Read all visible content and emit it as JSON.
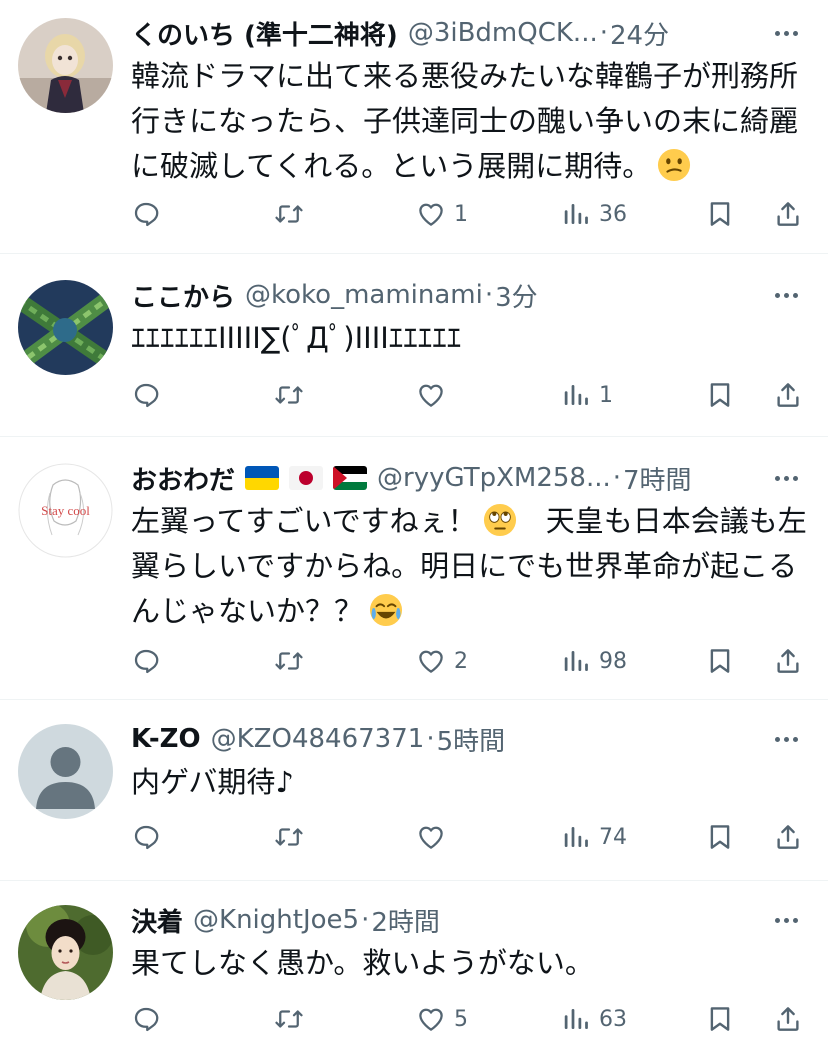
{
  "tweets": [
    {
      "name": "くのいち (準十二神将)",
      "handle": "@3iBdmQCK...",
      "sep": "·",
      "time": "24分",
      "text": "韓流ドラマに出て来る悪役みたいな韓鶴子が刑務所行きになったら、子供達同士の醜い争いの末に綺麗に破滅してくれる。という展開に期待。",
      "trailing_emoji": "confused-face",
      "likes": "1",
      "views": "36"
    },
    {
      "name": "ここから",
      "handle": "@koko_maminami",
      "sep": "·",
      "time": "3分",
      "text": "ｴｴｴｴｴｴIIIII∑(ﾟДﾟ)IIIIｴｴｴｴｴ",
      "likes": "",
      "views": "1"
    },
    {
      "name": "おおわだ",
      "flags": [
        "ukraine-flag",
        "japan-flag",
        "palestine-flag"
      ],
      "handle": "@ryyGTpXM258...",
      "sep": "·",
      "time": "7時間",
      "text_part1": "左翼ってすごいですねぇ！",
      "text_part2": "　天皇も日本会議も左翼らしいですからね。明日にでも世界革命が起こるんじゃないか？？",
      "avatar_text": "Stay cool",
      "likes": "2",
      "views": "98"
    },
    {
      "name": "K-ZO",
      "handle": "@KZO48467371",
      "sep": "·",
      "time": "5時間",
      "text": "内ゲバ期待♪",
      "likes": "",
      "views": "74"
    },
    {
      "name": "決着",
      "handle": "@KnightJoe5",
      "sep": "·",
      "time": "2時間",
      "text": "果てしなく愚か。救いようがない。",
      "likes": "5",
      "views": "63"
    }
  ],
  "colors": {
    "secondary": "#536471",
    "divider": "#eff3f4",
    "text": "#0f1419"
  },
  "icons": [
    "reply-icon",
    "retweet-icon",
    "like-icon",
    "views-icon",
    "bookmark-icon",
    "share-icon",
    "more-icon"
  ]
}
